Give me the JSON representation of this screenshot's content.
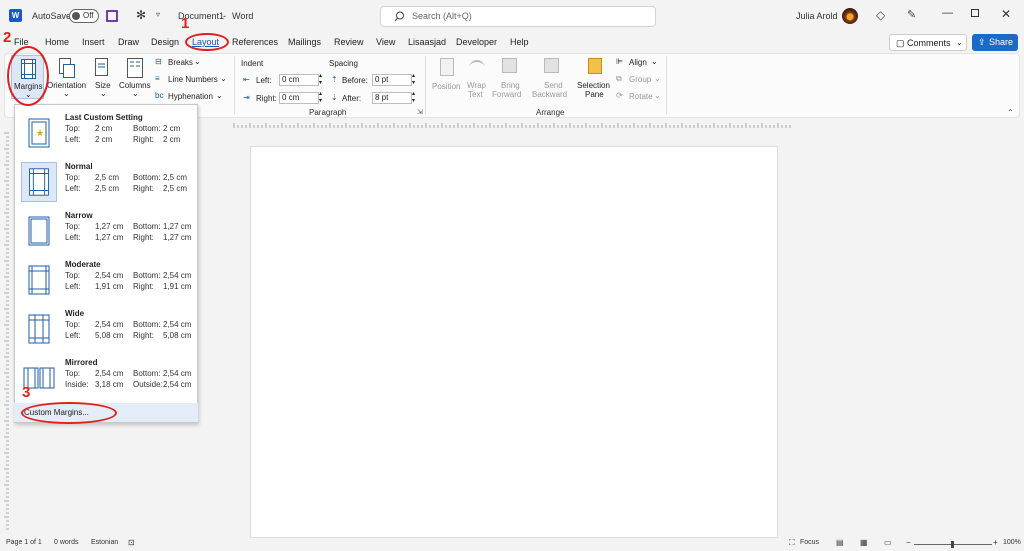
{
  "titlebar": {
    "autosave_label": "AutoSave",
    "autosave_state": "Off",
    "doc_title": "Document1",
    "title_sep": "-",
    "app_name": "Word",
    "search_placeholder": "Search (Alt+Q)",
    "user_name": "Julia Arold"
  },
  "menu": {
    "items": [
      "File",
      "Home",
      "Insert",
      "Draw",
      "Design",
      "Layout",
      "References",
      "Mailings",
      "Review",
      "View",
      "Lisaasjad",
      "Developer",
      "Help"
    ],
    "active": "Layout",
    "comments_label": "Comments",
    "share_label": "Share"
  },
  "ribbon": {
    "margins": "Margins",
    "orientation": "Orientation",
    "size": "Size",
    "columns": "Columns",
    "breaks": "Breaks",
    "line_numbers": "Line Numbers",
    "hyphenation": "Hyphenation",
    "indent_title": "Indent",
    "indent_left_label": "Left:",
    "indent_left_value": "0 cm",
    "indent_right_label": "Right:",
    "indent_right_value": "0 cm",
    "spacing_title": "Spacing",
    "before_label": "Before:",
    "before_value": "0 pt",
    "after_label": "After:",
    "after_value": "8 pt",
    "paragraph_group": "Paragraph",
    "position": "Position",
    "wrap_text_1": "Wrap",
    "wrap_text_2": "Text",
    "bring_forward_1": "Bring",
    "bring_forward_2": "Forward",
    "send_backward_1": "Send",
    "send_backward_2": "Backward",
    "selection_pane_1": "Selection",
    "selection_pane_2": "Pane",
    "align": "Align",
    "group": "Group",
    "rotate": "Rotate",
    "arrange_group": "Arrange"
  },
  "margins_menu": {
    "options": [
      {
        "name": "Last Custom Setting",
        "top_label": "Top:",
        "top": "2 cm",
        "bottom_label": "Bottom:",
        "bottom": "2 cm",
        "left_label": "Left:",
        "left": "2 cm",
        "right_label": "Right:",
        "right": "2 cm"
      },
      {
        "name": "Normal",
        "top_label": "Top:",
        "top": "2,5 cm",
        "bottom_label": "Bottom:",
        "bottom": "2,5 cm",
        "left_label": "Left:",
        "left": "2,5 cm",
        "right_label": "Right:",
        "right": "2,5 cm"
      },
      {
        "name": "Narrow",
        "top_label": "Top:",
        "top": "1,27 cm",
        "bottom_label": "Bottom:",
        "bottom": "1,27 cm",
        "left_label": "Left:",
        "left": "1,27 cm",
        "right_label": "Right:",
        "right": "1,27 cm"
      },
      {
        "name": "Moderate",
        "top_label": "Top:",
        "top": "2,54 cm",
        "bottom_label": "Bottom:",
        "bottom": "2,54 cm",
        "left_label": "Left:",
        "left": "1,91 cm",
        "right_label": "Right:",
        "right": "1,91 cm"
      },
      {
        "name": "Wide",
        "top_label": "Top:",
        "top": "2,54 cm",
        "bottom_label": "Bottom:",
        "bottom": "2,54 cm",
        "left_label": "Left:",
        "left": "5,08 cm",
        "right_label": "Right:",
        "right": "5,08 cm"
      },
      {
        "name": "Mirrored",
        "top_label": "Top:",
        "top": "2,54 cm",
        "bottom_label": "Bottom:",
        "bottom": "2,54 cm",
        "left_label": "Inside:",
        "left": "3,18 cm",
        "right_label": "Outside:",
        "right": "2,54 cm"
      }
    ],
    "custom": "Custom Margins..."
  },
  "annotations": {
    "step1": "1",
    "step2": "2",
    "step3": "3"
  },
  "status": {
    "page": "Page 1 of 1",
    "words": "0 words",
    "language": "Estonian",
    "focus": "Focus",
    "zoom": "100%"
  },
  "colors": {
    "accent": "#1b6ac9",
    "annotation": "#e0201a",
    "word_blue": "#185abd"
  }
}
